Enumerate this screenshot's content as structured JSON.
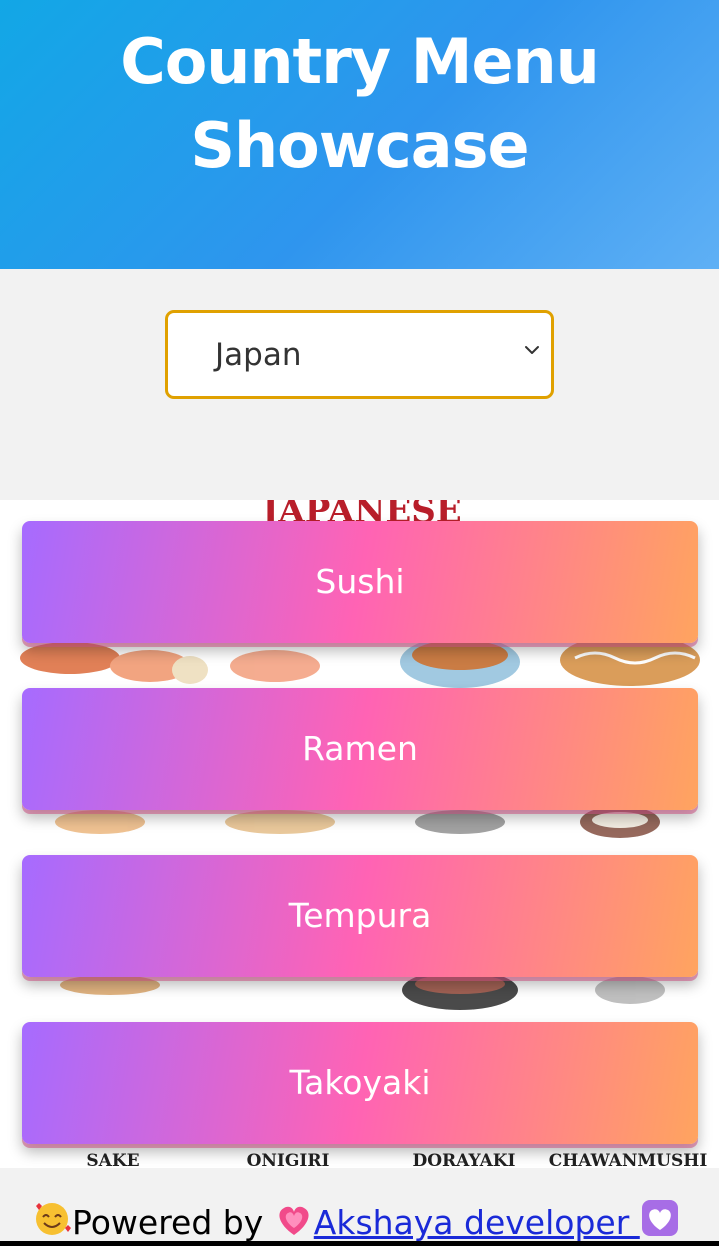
{
  "header": {
    "title_line1": "Country Menu",
    "title_line2": "Showcase"
  },
  "country_select": {
    "selected": "Japan"
  },
  "poster": {
    "banner_text": "JAPANESE",
    "captions": [
      "SAKE",
      "ONIGIRI",
      "DORAYAKI",
      "CHAWANMUSHI"
    ]
  },
  "menu_items": [
    {
      "label": "Sushi"
    },
    {
      "label": "Ramen"
    },
    {
      "label": "Tempura"
    },
    {
      "label": "Takoyaki"
    }
  ],
  "footer": {
    "powered_by": "Powered by ",
    "link_text": "Akshaya developer "
  },
  "colors": {
    "header_gradient_start": "#12a7e6",
    "header_gradient_end": "#5fb0f5",
    "select_border": "#e0a100",
    "button_gradient": [
      "#a66bff",
      "#ff63b4",
      "#ffa45f"
    ],
    "link": "#1a2ad8"
  }
}
